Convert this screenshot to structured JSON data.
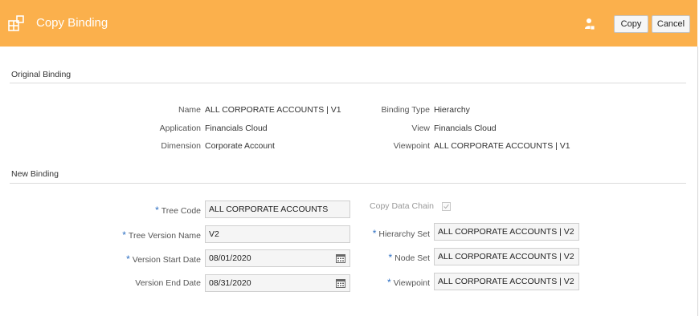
{
  "header": {
    "title": "Copy Binding",
    "copy_label": "Copy",
    "cancel_label": "Cancel",
    "accent": "#fbb04c"
  },
  "original": {
    "section_title": "Original Binding",
    "name_label": "Name",
    "name_value": "ALL CORPORATE ACCOUNTS | V1",
    "application_label": "Application",
    "application_value": "Financials Cloud",
    "dimension_label": "Dimension",
    "dimension_value": "Corporate Account",
    "binding_type_label": "Binding Type",
    "binding_type_value": "Hierarchy",
    "view_label": "View",
    "view_value": "Financials Cloud",
    "viewpoint_label": "Viewpoint",
    "viewpoint_value": "ALL CORPORATE ACCOUNTS | V1"
  },
  "new_binding": {
    "section_title": "New Binding",
    "required_marker": "*",
    "tree_code_label": "Tree Code",
    "tree_code_value": "ALL CORPORATE ACCOUNTS",
    "tree_version_name_label": "Tree Version Name",
    "tree_version_name_value": "V2",
    "version_start_date_label": "Version Start Date",
    "version_start_date_value": "08/01/2020",
    "version_end_date_label": "Version End Date",
    "version_end_date_value": "08/31/2020",
    "copy_data_chain_label": "Copy Data Chain",
    "copy_data_chain_checked": true,
    "hierarchy_set_label": "Hierarchy Set",
    "hierarchy_set_value": "ALL CORPORATE ACCOUNTS | V2",
    "node_set_label": "Node Set",
    "node_set_value": "ALL CORPORATE ACCOUNTS | V2",
    "viewpoint_label": "Viewpoint",
    "viewpoint_value": "ALL CORPORATE ACCOUNTS | V2"
  }
}
